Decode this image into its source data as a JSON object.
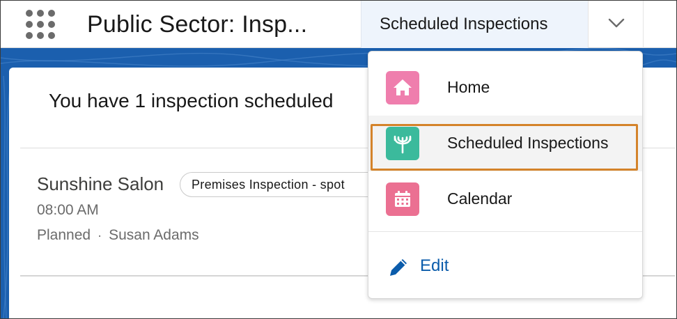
{
  "header": {
    "app_title": "Public Sector: Insp...",
    "active_tab": "Scheduled Inspections"
  },
  "main": {
    "heading": "You have 1 inspection scheduled",
    "record": {
      "name": "Sunshine Salon",
      "type_badge": "Premises Inspection - spot",
      "time": "08:00 AM",
      "status": "Planned",
      "separator": "·",
      "owner": "Susan Adams"
    }
  },
  "nav_menu": {
    "items": [
      {
        "label": "Home",
        "icon": "home-icon",
        "color": "#ef7ead"
      },
      {
        "label": "Scheduled Inspections",
        "icon": "inspection-icon",
        "color": "#3bba9c",
        "selected": true
      },
      {
        "label": "Calendar",
        "icon": "calendar-icon",
        "color": "#eb7092"
      }
    ],
    "edit_label": "Edit"
  },
  "colors": {
    "brand_blue": "#1b5fae",
    "link_blue": "#0b5cab",
    "highlight_orange": "#d4832a"
  }
}
